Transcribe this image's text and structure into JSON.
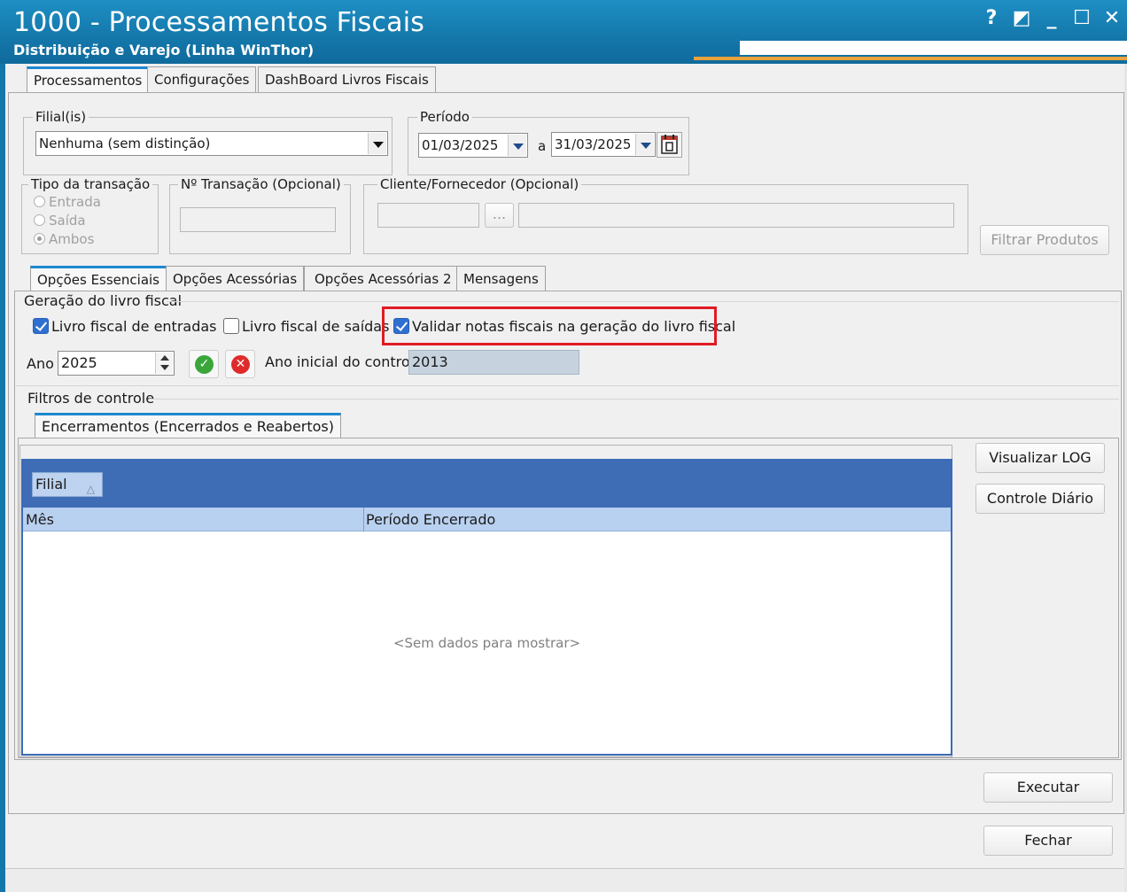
{
  "window": {
    "title": "1000 - Processamentos Fiscais",
    "subtitle": "Distribuição e Varejo (Linha WinThor)",
    "controls": [
      "?",
      "◩",
      "_",
      "☐",
      "✕"
    ]
  },
  "main_tabs": [
    "Processamentos",
    "Configurações",
    "DashBoard Livros Fiscais"
  ],
  "filial": {
    "legend": "Filial(is)",
    "value": "Nenhuma (sem distinção)"
  },
  "periodo": {
    "legend": "Período",
    "start": "01/03/2025",
    "separator": "a",
    "end": "31/03/2025"
  },
  "tipo_transacao": {
    "legend": "Tipo da transação",
    "options": [
      "Entrada",
      "Saída",
      "Ambos"
    ],
    "selected": "Ambos"
  },
  "num_transacao": {
    "legend": "Nº Transação (Opcional)",
    "value": ""
  },
  "cliente": {
    "legend": "Cliente/Fornecedor (Opcional)",
    "code": "",
    "lookup_label": "...",
    "name": ""
  },
  "filtrar_button": "Filtrar Produtos",
  "sub_tabs": [
    "Opções Essenciais",
    "Opções Acessórias",
    "Opções Acessórias 2",
    "Mensagens"
  ],
  "geracao": {
    "title": "Geração do livro fiscal",
    "livro_entradas": {
      "label": "Livro fiscal de entradas",
      "checked": true
    },
    "livro_saidas": {
      "label": "Livro fiscal de saídas",
      "checked": false
    },
    "validar_notas": {
      "label": "Validar notas fiscais na geração do livro fiscal",
      "checked": true
    },
    "ano_label": "Ano",
    "ano_value": "2025",
    "ano_inicial_label": "Ano inicial do controle",
    "ano_inicial_value": "2013"
  },
  "filtros": {
    "title": "Filtros de controle",
    "tab": "Encerramentos (Encerrados e Reabertos)",
    "group_chip": "Filial",
    "columns": [
      "Mês",
      "Período Encerrado"
    ],
    "empty_text": "<Sem dados para mostrar>"
  },
  "side_buttons": [
    "Visualizar LOG",
    "Controle Diário"
  ],
  "bottom_buttons": {
    "executar": "Executar",
    "fechar": "Fechar"
  },
  "colors": {
    "titlebar": "#1477aa",
    "accent_tab": "#1e88d0",
    "highlight_box": "#e01b24",
    "grid_group": "#3e6db6",
    "grid_header": "#b9d1f0"
  }
}
